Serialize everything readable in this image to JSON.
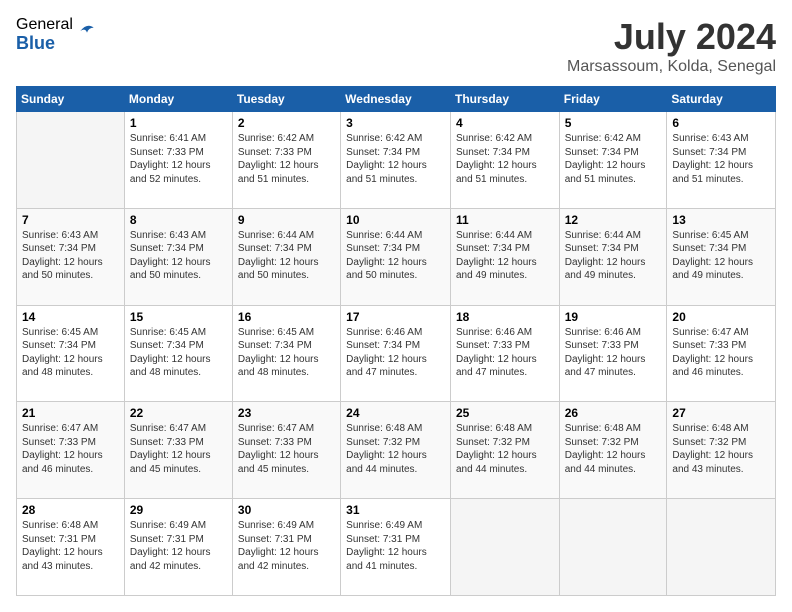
{
  "logo": {
    "general": "General",
    "blue": "Blue"
  },
  "header": {
    "month": "July 2024",
    "location": "Marsassoum, Kolda, Senegal"
  },
  "days_of_week": [
    "Sunday",
    "Monday",
    "Tuesday",
    "Wednesday",
    "Thursday",
    "Friday",
    "Saturday"
  ],
  "weeks": [
    [
      {
        "day": "",
        "sunrise": "",
        "sunset": "",
        "daylight": ""
      },
      {
        "day": "1",
        "sunrise": "Sunrise: 6:41 AM",
        "sunset": "Sunset: 7:33 PM",
        "daylight": "Daylight: 12 hours and 52 minutes."
      },
      {
        "day": "2",
        "sunrise": "Sunrise: 6:42 AM",
        "sunset": "Sunset: 7:33 PM",
        "daylight": "Daylight: 12 hours and 51 minutes."
      },
      {
        "day": "3",
        "sunrise": "Sunrise: 6:42 AM",
        "sunset": "Sunset: 7:34 PM",
        "daylight": "Daylight: 12 hours and 51 minutes."
      },
      {
        "day": "4",
        "sunrise": "Sunrise: 6:42 AM",
        "sunset": "Sunset: 7:34 PM",
        "daylight": "Daylight: 12 hours and 51 minutes."
      },
      {
        "day": "5",
        "sunrise": "Sunrise: 6:42 AM",
        "sunset": "Sunset: 7:34 PM",
        "daylight": "Daylight: 12 hours and 51 minutes."
      },
      {
        "day": "6",
        "sunrise": "Sunrise: 6:43 AM",
        "sunset": "Sunset: 7:34 PM",
        "daylight": "Daylight: 12 hours and 51 minutes."
      }
    ],
    [
      {
        "day": "7",
        "sunrise": "Sunrise: 6:43 AM",
        "sunset": "Sunset: 7:34 PM",
        "daylight": "Daylight: 12 hours and 50 minutes."
      },
      {
        "day": "8",
        "sunrise": "Sunrise: 6:43 AM",
        "sunset": "Sunset: 7:34 PM",
        "daylight": "Daylight: 12 hours and 50 minutes."
      },
      {
        "day": "9",
        "sunrise": "Sunrise: 6:44 AM",
        "sunset": "Sunset: 7:34 PM",
        "daylight": "Daylight: 12 hours and 50 minutes."
      },
      {
        "day": "10",
        "sunrise": "Sunrise: 6:44 AM",
        "sunset": "Sunset: 7:34 PM",
        "daylight": "Daylight: 12 hours and 50 minutes."
      },
      {
        "day": "11",
        "sunrise": "Sunrise: 6:44 AM",
        "sunset": "Sunset: 7:34 PM",
        "daylight": "Daylight: 12 hours and 49 minutes."
      },
      {
        "day": "12",
        "sunrise": "Sunrise: 6:44 AM",
        "sunset": "Sunset: 7:34 PM",
        "daylight": "Daylight: 12 hours and 49 minutes."
      },
      {
        "day": "13",
        "sunrise": "Sunrise: 6:45 AM",
        "sunset": "Sunset: 7:34 PM",
        "daylight": "Daylight: 12 hours and 49 minutes."
      }
    ],
    [
      {
        "day": "14",
        "sunrise": "Sunrise: 6:45 AM",
        "sunset": "Sunset: 7:34 PM",
        "daylight": "Daylight: 12 hours and 48 minutes."
      },
      {
        "day": "15",
        "sunrise": "Sunrise: 6:45 AM",
        "sunset": "Sunset: 7:34 PM",
        "daylight": "Daylight: 12 hours and 48 minutes."
      },
      {
        "day": "16",
        "sunrise": "Sunrise: 6:45 AM",
        "sunset": "Sunset: 7:34 PM",
        "daylight": "Daylight: 12 hours and 48 minutes."
      },
      {
        "day": "17",
        "sunrise": "Sunrise: 6:46 AM",
        "sunset": "Sunset: 7:34 PM",
        "daylight": "Daylight: 12 hours and 47 minutes."
      },
      {
        "day": "18",
        "sunrise": "Sunrise: 6:46 AM",
        "sunset": "Sunset: 7:33 PM",
        "daylight": "Daylight: 12 hours and 47 minutes."
      },
      {
        "day": "19",
        "sunrise": "Sunrise: 6:46 AM",
        "sunset": "Sunset: 7:33 PM",
        "daylight": "Daylight: 12 hours and 47 minutes."
      },
      {
        "day": "20",
        "sunrise": "Sunrise: 6:47 AM",
        "sunset": "Sunset: 7:33 PM",
        "daylight": "Daylight: 12 hours and 46 minutes."
      }
    ],
    [
      {
        "day": "21",
        "sunrise": "Sunrise: 6:47 AM",
        "sunset": "Sunset: 7:33 PM",
        "daylight": "Daylight: 12 hours and 46 minutes."
      },
      {
        "day": "22",
        "sunrise": "Sunrise: 6:47 AM",
        "sunset": "Sunset: 7:33 PM",
        "daylight": "Daylight: 12 hours and 45 minutes."
      },
      {
        "day": "23",
        "sunrise": "Sunrise: 6:47 AM",
        "sunset": "Sunset: 7:33 PM",
        "daylight": "Daylight: 12 hours and 45 minutes."
      },
      {
        "day": "24",
        "sunrise": "Sunrise: 6:48 AM",
        "sunset": "Sunset: 7:32 PM",
        "daylight": "Daylight: 12 hours and 44 minutes."
      },
      {
        "day": "25",
        "sunrise": "Sunrise: 6:48 AM",
        "sunset": "Sunset: 7:32 PM",
        "daylight": "Daylight: 12 hours and 44 minutes."
      },
      {
        "day": "26",
        "sunrise": "Sunrise: 6:48 AM",
        "sunset": "Sunset: 7:32 PM",
        "daylight": "Daylight: 12 hours and 44 minutes."
      },
      {
        "day": "27",
        "sunrise": "Sunrise: 6:48 AM",
        "sunset": "Sunset: 7:32 PM",
        "daylight": "Daylight: 12 hours and 43 minutes."
      }
    ],
    [
      {
        "day": "28",
        "sunrise": "Sunrise: 6:48 AM",
        "sunset": "Sunset: 7:31 PM",
        "daylight": "Daylight: 12 hours and 43 minutes."
      },
      {
        "day": "29",
        "sunrise": "Sunrise: 6:49 AM",
        "sunset": "Sunset: 7:31 PM",
        "daylight": "Daylight: 12 hours and 42 minutes."
      },
      {
        "day": "30",
        "sunrise": "Sunrise: 6:49 AM",
        "sunset": "Sunset: 7:31 PM",
        "daylight": "Daylight: 12 hours and 42 minutes."
      },
      {
        "day": "31",
        "sunrise": "Sunrise: 6:49 AM",
        "sunset": "Sunset: 7:31 PM",
        "daylight": "Daylight: 12 hours and 41 minutes."
      },
      {
        "day": "",
        "sunrise": "",
        "sunset": "",
        "daylight": ""
      },
      {
        "day": "",
        "sunrise": "",
        "sunset": "",
        "daylight": ""
      },
      {
        "day": "",
        "sunrise": "",
        "sunset": "",
        "daylight": ""
      }
    ]
  ]
}
